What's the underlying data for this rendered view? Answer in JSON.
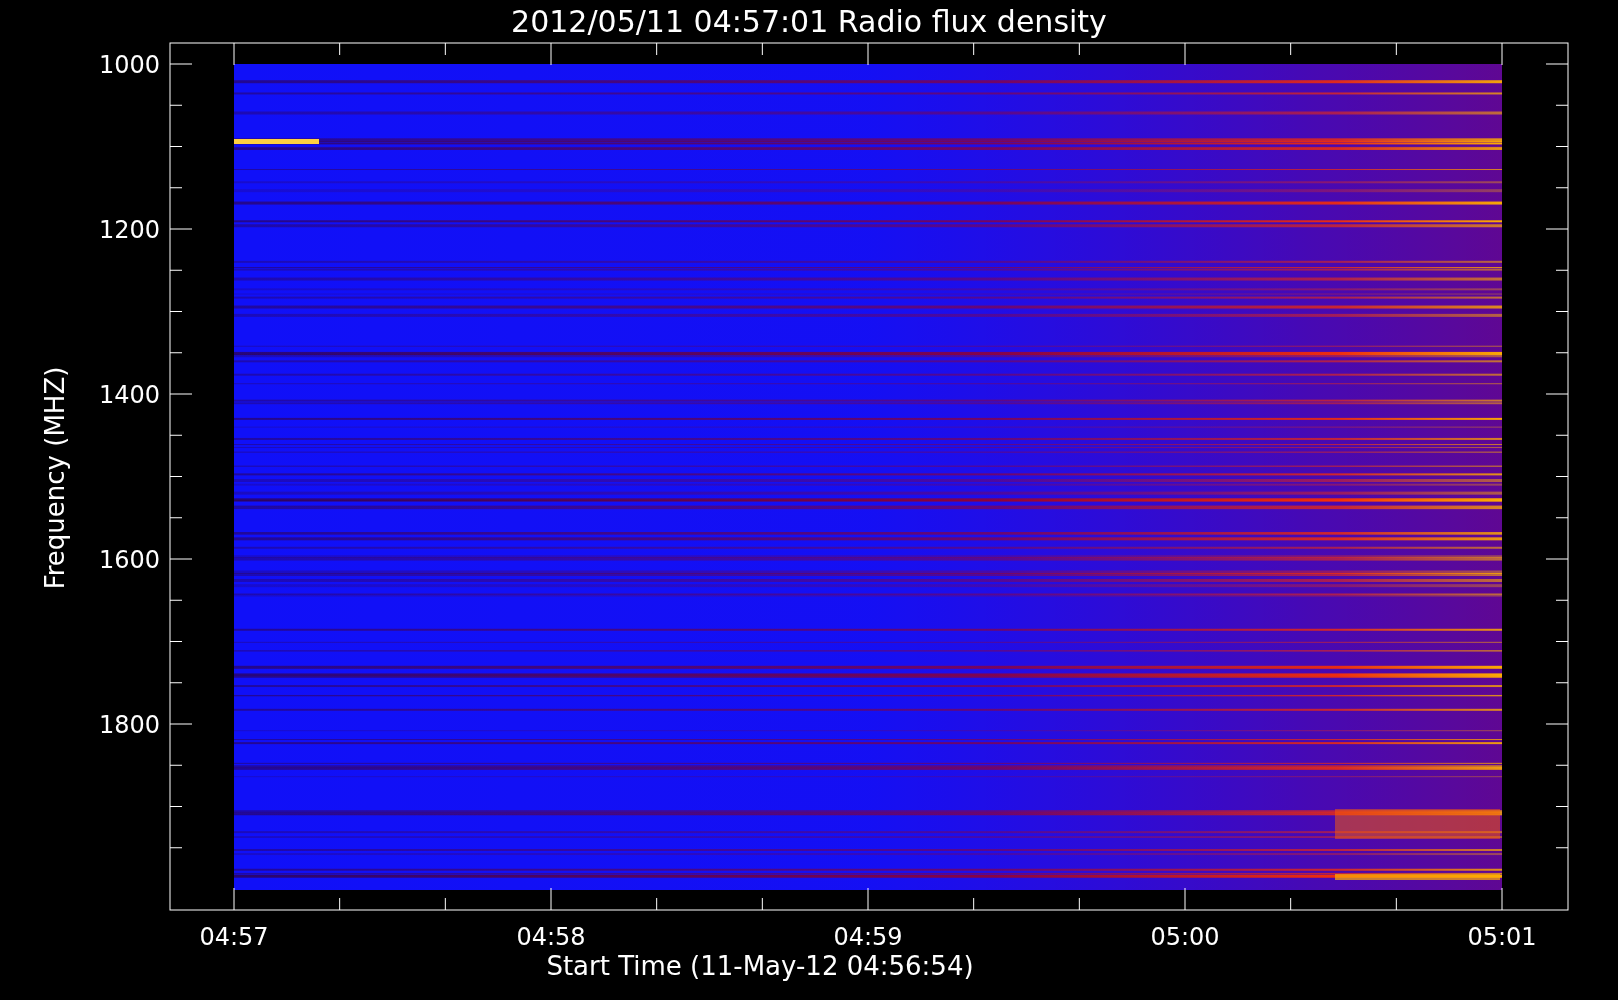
{
  "title": "2012/05/11 04:57:01 Radio flux density",
  "y_axis": {
    "label": "Frequency (MHZ)",
    "ticks": [
      "1000",
      "1200",
      "1400",
      "1600",
      "1800"
    ]
  },
  "x_axis": {
    "label": "Start Time (11-May-12 04:56:54)",
    "ticks": [
      "04:57",
      "04:58",
      "04:59",
      "05:00",
      "05:01"
    ]
  }
}
